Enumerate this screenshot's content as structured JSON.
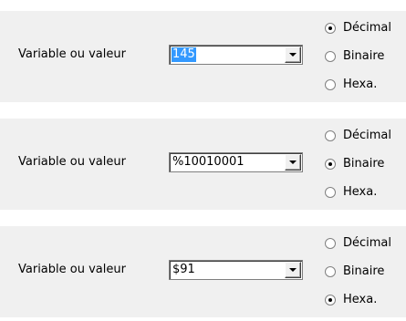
{
  "groups": [
    {
      "label": "Variable ou valeur",
      "value": "145",
      "value_selected": true,
      "options": [
        "Décimal",
        "Binaire",
        "Hexa."
      ],
      "checked_index": 0
    },
    {
      "label": "Variable ou valeur",
      "value": "%10010001",
      "value_selected": false,
      "options": [
        "Décimal",
        "Binaire",
        "Hexa."
      ],
      "checked_index": 1
    },
    {
      "label": "Variable ou valeur",
      "value": "$91",
      "value_selected": false,
      "options": [
        "Décimal",
        "Binaire",
        "Hexa."
      ],
      "checked_index": 2
    }
  ],
  "icons": {
    "dropdown": "chevron-down-icon",
    "radio_checked": "radio-checked-icon",
    "radio_unchecked": "radio-unchecked-icon"
  },
  "colors": {
    "panel_background": "#f0f0f0",
    "selection_highlight": "#3399ff"
  }
}
